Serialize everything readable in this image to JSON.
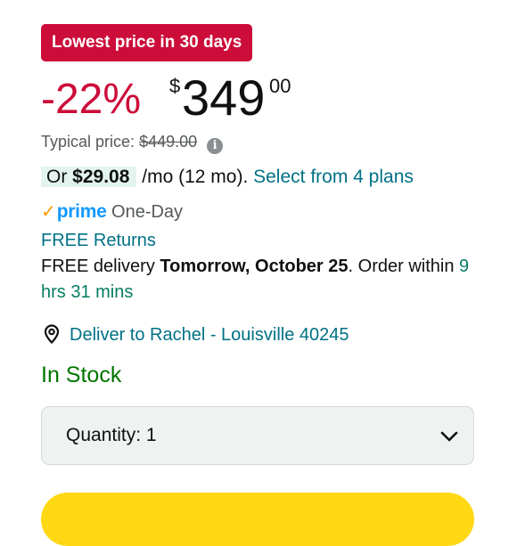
{
  "badge": {
    "text": "Lowest price in 30 days"
  },
  "price": {
    "discount": "-22%",
    "currency_symbol": "$",
    "whole": "349",
    "fraction": "00"
  },
  "typical": {
    "label": "Typical price:",
    "value": "$449.00",
    "info_icon": "info-icon"
  },
  "plan": {
    "prefix": "Or",
    "monthly": "$29.08",
    "term": "/mo (12 mo).",
    "link": "Select from 4 plans"
  },
  "prime": {
    "check_icon": "✓",
    "word": "prime",
    "tag": "One-Day"
  },
  "returns": {
    "label": "FREE Returns"
  },
  "delivery": {
    "prefix": "FREE delivery",
    "date": "Tomorrow, October 25",
    "mid": ". Order within",
    "countdown": "9 hrs 31 mins"
  },
  "location": {
    "icon": "location-pin-icon",
    "text": "Deliver to Rachel - Louisville 40245"
  },
  "stock": {
    "status": "In Stock"
  },
  "quantity": {
    "label": "Quantity:",
    "value": "1",
    "icon": "chevron-down-icon"
  },
  "colors": {
    "badge_red": "#cc0c39",
    "link_teal": "#007185",
    "prime_blue": "#1399ff",
    "prime_check": "#ff9900",
    "in_stock_green": "#007600",
    "countdown_green": "#067d62",
    "buy_button_yellow": "#ffd814"
  }
}
